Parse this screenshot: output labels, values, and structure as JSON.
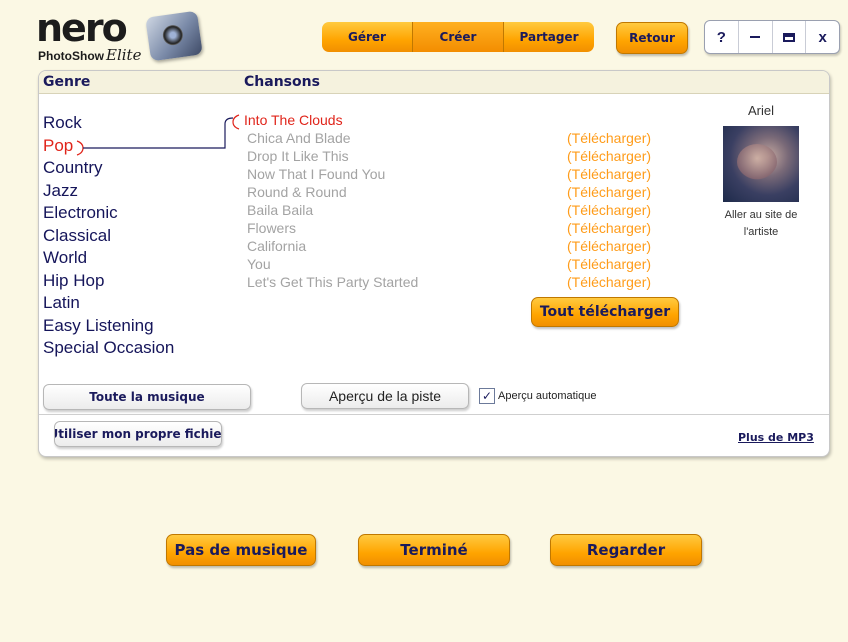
{
  "logo": {
    "brand": "nero",
    "product": "PhotoShow",
    "edition": "Elite"
  },
  "nav": {
    "tabs": [
      {
        "label": "Gérer"
      },
      {
        "label": "Créer"
      },
      {
        "label": "Partager"
      }
    ],
    "selected_tab": "Créer",
    "back_label": "Retour"
  },
  "window_controls": {
    "help": "?",
    "close": "x"
  },
  "panel": {
    "genre_header": "Genre",
    "songs_header": "Chansons",
    "genres": [
      "Rock",
      "Pop",
      "Country",
      "Jazz",
      "Electronic",
      "Classical",
      "World",
      "Hip Hop",
      "Latin",
      "Easy Listening",
      "Special Occasion"
    ],
    "selected_genre": "Pop",
    "songs": [
      {
        "title": "Into The Clouds",
        "download": ""
      },
      {
        "title": "Chica And Blade",
        "download": "(Télécharger)"
      },
      {
        "title": "Drop It Like This",
        "download": "(Télécharger)"
      },
      {
        "title": "Now That I Found You",
        "download": "(Télécharger)"
      },
      {
        "title": "Round & Round",
        "download": "(Télécharger)"
      },
      {
        "title": "Baila Baila",
        "download": "(Télécharger)"
      },
      {
        "title": "Flowers",
        "download": "(Télécharger)"
      },
      {
        "title": "California",
        "download": "(Télécharger)"
      },
      {
        "title": "You",
        "download": "(Télécharger)"
      },
      {
        "title": "Let's Get This Party Started",
        "download": "(Télécharger)"
      }
    ],
    "download_all_label": "Tout télécharger",
    "artist": {
      "name": "Ariel",
      "link_line1": "Aller au site de",
      "link_line2": "l'artiste"
    },
    "all_music_label": "Toute la musique",
    "preview_label": "Aperçu de la piste",
    "auto_preview_label": "Aperçu automatique",
    "auto_preview_checked": true,
    "own_file_label": "Utiliser mon propre fichier",
    "more_mp3_label": "Plus de MP3"
  },
  "footer": {
    "no_music_label": "Pas de musique",
    "done_label": "Terminé",
    "watch_label": "Regarder"
  },
  "colors": {
    "accent_orange": "#ffa400",
    "selected_red": "#e0241a",
    "navy_text": "#1a1a5c"
  }
}
